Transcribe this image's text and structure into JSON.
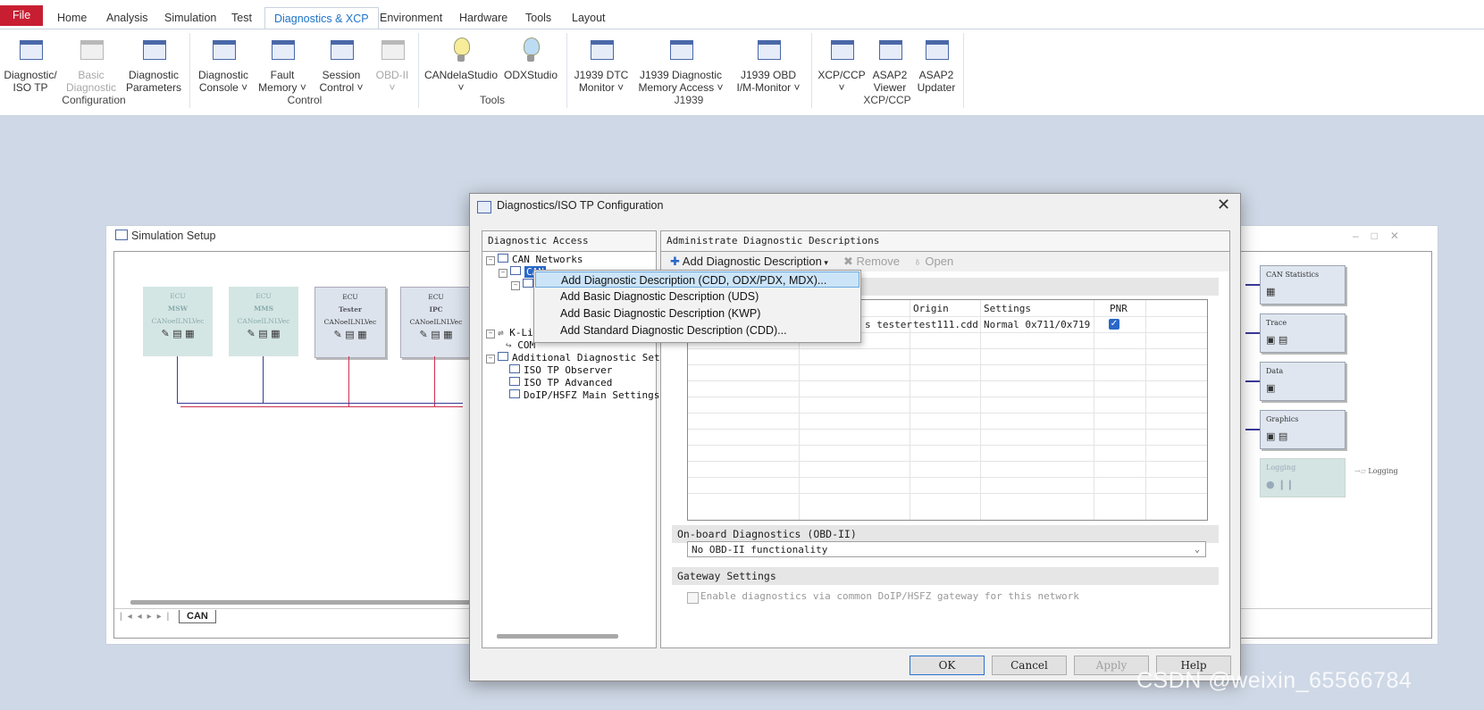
{
  "ribbon": {
    "tabs": [
      "File",
      "Home",
      "Analysis",
      "Simulation",
      "Test",
      "Diagnostics & XCP",
      "Environment",
      "Hardware",
      "Tools",
      "Layout"
    ],
    "active_tab": "Diagnostics & XCP",
    "buttons": [
      {
        "line1": "Diagnostic/",
        "line2": "ISO TP",
        "enabled": true
      },
      {
        "line1": "Basic",
        "line2": "Diagnostic",
        "enabled": false
      },
      {
        "line1": "Diagnostic",
        "line2": "Parameters",
        "enabled": true
      },
      {
        "line1": "Diagnostic",
        "line2": "Console ˅",
        "enabled": true
      },
      {
        "line1": "Fault",
        "line2": "Memory ˅",
        "enabled": true
      },
      {
        "line1": "Session",
        "line2": "Control ˅",
        "enabled": true
      },
      {
        "line1": "OBD-II",
        "line2": "˅",
        "enabled": false
      },
      {
        "line1": "CANdelaStudio",
        "line2": "˅",
        "enabled": true
      },
      {
        "line1": "ODXStudio",
        "line2": "",
        "enabled": true
      },
      {
        "line1": "J1939 DTC",
        "line2": "Monitor ˅",
        "enabled": true
      },
      {
        "line1": "J1939 Diagnostic",
        "line2": "Memory Access ˅",
        "enabled": true
      },
      {
        "line1": "J1939 OBD",
        "line2": "I/M-Monitor ˅",
        "enabled": true
      },
      {
        "line1": "XCP/CCP",
        "line2": "˅",
        "enabled": true
      },
      {
        "line1": "ASAP2",
        "line2": "Viewer",
        "enabled": true
      },
      {
        "line1": "ASAP2",
        "line2": "Updater",
        "enabled": true
      }
    ],
    "groups": [
      "Configuration",
      "Control",
      "Tools",
      "J1939",
      "XCP/CCP"
    ]
  },
  "simulation": {
    "title": "Simulation Setup",
    "ecus": [
      {
        "type": "ECU",
        "name": "MSW",
        "node": "CANoeILNLVec"
      },
      {
        "type": "ECU",
        "name": "MMS",
        "node": "CANoeILNLVec"
      },
      {
        "type": "ECU",
        "name": "Tester",
        "node": "CANoeILNLVec"
      },
      {
        "type": "ECU",
        "name": "IPC",
        "node": "CANoeILNLVec"
      }
    ],
    "blocks": [
      "CAN Statistics",
      "Trace",
      "Data",
      "Graphics",
      "Logging"
    ],
    "logging_label": "Logging",
    "sheet_tab": "CAN"
  },
  "dialog": {
    "title": "Diagnostics/ISO TP Configuration",
    "left_header": "Diagnostic Access",
    "tree": {
      "can_networks": "CAN Networks",
      "can": "CAN",
      "k_line": "K-Li",
      "com": "COM",
      "additional": "Additional Diagnostic Set",
      "iso_observer": "ISO TP Observer",
      "iso_advanced": "ISO TP Advanced",
      "doip": "DoIP/HSFZ Main Settings"
    },
    "right_header": "Administrate Diagnostic Descriptions",
    "toolbar": {
      "add": "Add Diagnostic Description",
      "remove": "Remove",
      "open": "Open"
    },
    "table": {
      "headers": [
        "Origin",
        "Settings",
        "PNR"
      ],
      "row": {
        "name_tail": "s tester",
        "origin": "test111.cdd",
        "settings": "Normal 0x711/0x719",
        "pnr": true
      }
    },
    "obd": {
      "title": "On-board Diagnostics (OBD-II)",
      "value": "No OBD-II functionality"
    },
    "gateway": {
      "title": "Gateway Settings",
      "checkbox": "Enable diagnostics via common DoIP/HSFZ gateway for this network",
      "checked": false
    },
    "buttons": {
      "ok": "OK",
      "cancel": "Cancel",
      "apply": "Apply",
      "help": "Help"
    }
  },
  "context_menu": {
    "items": [
      "Add Diagnostic Description (CDD, ODX/PDX, MDX)...",
      "Add Basic Diagnostic Description (UDS)",
      "Add Basic Diagnostic Description (KWP)",
      "Add Standard Diagnostic Description (CDD)..."
    ],
    "highlighted": 0
  },
  "watermark": "CSDN @weixin_65566784",
  "colors": {
    "file_tab": "#c81e32",
    "active_tab": "#1e73c8",
    "bus": "#3a3a9a",
    "red_bus": "#d03050",
    "checkbox": "#2a68c8",
    "highlight": "#cce4f7"
  }
}
